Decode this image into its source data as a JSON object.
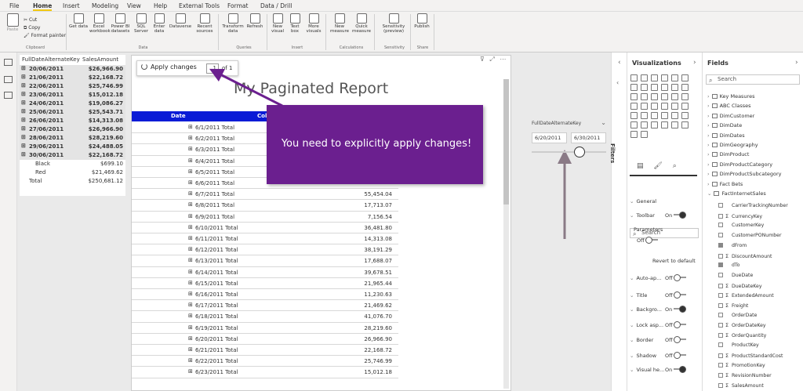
{
  "menu": {
    "tabs": [
      "File",
      "Home",
      "Insert",
      "Modeling",
      "View",
      "Help",
      "External Tools",
      "Format",
      "Data / Drill"
    ],
    "active": "Home"
  },
  "ribbon": {
    "clipboard": {
      "paste": "Paste",
      "cut": "Cut",
      "copy": "Copy",
      "format_painter": "Format painter",
      "group": "Clipboard"
    },
    "data_buttons": [
      "Get data",
      "Excel workbook",
      "Power BI datasets",
      "SQL Server",
      "Enter data",
      "Dataverse",
      "Recent sources"
    ],
    "data_group": "Data",
    "queries_buttons": [
      "Transform data",
      "Refresh"
    ],
    "queries_group": "Queries",
    "insert_buttons": [
      "New visual",
      "Text box",
      "More visuals"
    ],
    "insert_group": "Insert",
    "calc_buttons": [
      "New measure",
      "Quick measure"
    ],
    "calc_group": "Calculations",
    "sens_buttons": [
      "Sensitivity (preview)"
    ],
    "sens_group": "Sensitivity",
    "share_buttons": [
      "Publish"
    ],
    "share_group": "Share"
  },
  "matrix": {
    "headers": [
      "FullDateAlternateKey",
      "SalesAmount"
    ],
    "rows": [
      {
        "key": "20/06/2011",
        "value": "$26,966.90",
        "bold": true
      },
      {
        "key": "21/06/2011",
        "value": "$22,168.72",
        "bold": true
      },
      {
        "key": "22/06/2011",
        "value": "$25,746.99",
        "bold": true
      },
      {
        "key": "23/06/2011",
        "value": "$15,012.18",
        "bold": true
      },
      {
        "key": "24/06/2011",
        "value": "$19,086.27",
        "bold": true
      },
      {
        "key": "25/06/2011",
        "value": "$25,543.71",
        "bold": true
      },
      {
        "key": "26/06/2011",
        "value": "$14,313.08",
        "bold": true
      },
      {
        "key": "27/06/2011",
        "value": "$26,966.90",
        "bold": true
      },
      {
        "key": "28/06/2011",
        "value": "$28,219.60",
        "bold": true
      },
      {
        "key": "29/06/2011",
        "value": "$24,488.05",
        "bold": true
      },
      {
        "key": "30/06/2011",
        "value": "$22,168.72",
        "bold": true
      },
      {
        "key": "Black",
        "value": "$699.10",
        "bold": false
      },
      {
        "key": "Red",
        "value": "$21,469.62",
        "bold": false
      },
      {
        "key": "Total",
        "value": "$250,681.12",
        "bold": false
      }
    ]
  },
  "report": {
    "apply_label": "Apply changes",
    "page_value": "1",
    "page_of": "of 1",
    "title": "My Paginated Report",
    "col_date": "Date",
    "col_second": "Col",
    "rows": [
      {
        "date": "6/1/2011 Total",
        "amount": ""
      },
      {
        "date": "6/2/2011 Total",
        "amount": ""
      },
      {
        "date": "6/3/2011 Total",
        "amount": ""
      },
      {
        "date": "6/4/2011 Total",
        "amount": ""
      },
      {
        "date": "6/5/2011 Total",
        "amount": ""
      },
      {
        "date": "6/6/2011 Total",
        "amount": ""
      },
      {
        "date": "6/7/2011 Total",
        "amount": "55,454.04"
      },
      {
        "date": "6/8/2011 Total",
        "amount": "17,713.07"
      },
      {
        "date": "6/9/2011 Total",
        "amount": "7,156.54"
      },
      {
        "date": "6/10/2011 Total",
        "amount": "36,481.80"
      },
      {
        "date": "6/11/2011 Total",
        "amount": "14,313.08"
      },
      {
        "date": "6/12/2011 Total",
        "amount": "38,191.29"
      },
      {
        "date": "6/13/2011 Total",
        "amount": "17,688.07"
      },
      {
        "date": "6/14/2011 Total",
        "amount": "39,678.51"
      },
      {
        "date": "6/15/2011 Total",
        "amount": "21,965.44"
      },
      {
        "date": "6/16/2011 Total",
        "amount": "11,230.63"
      },
      {
        "date": "6/17/2011 Total",
        "amount": "21,469.62"
      },
      {
        "date": "6/18/2011 Total",
        "amount": "41,076.70"
      },
      {
        "date": "6/19/2011 Total",
        "amount": "28,219.60"
      },
      {
        "date": "6/20/2011 Total",
        "amount": "26,966.90"
      },
      {
        "date": "6/21/2011 Total",
        "amount": "22,168.72"
      },
      {
        "date": "6/22/2011 Total",
        "amount": "25,746.99"
      },
      {
        "date": "6/23/2011 Total",
        "amount": "15,012.18"
      }
    ]
  },
  "callout": "You need to explicitly apply changes!",
  "slicer": {
    "label": "FullDateAlternateKey",
    "from": "6/20/2011",
    "to": "6/30/2011"
  },
  "filters_label": "Filters",
  "viz": {
    "title": "Visualizations",
    "search": "Search",
    "sections": [
      {
        "label": "General"
      },
      {
        "label": "Toolbar",
        "state": "On"
      },
      {
        "label": "Parameters"
      },
      {
        "label": "Off",
        "state": "Off"
      },
      {
        "label": "Revert to default"
      },
      {
        "label": "Auto-ap...",
        "state": "Off"
      },
      {
        "label": "Title",
        "state": "Off"
      },
      {
        "label": "Backgro...",
        "state": "On"
      },
      {
        "label": "Lock asp...",
        "state": "Off"
      },
      {
        "label": "Border",
        "state": "Off"
      },
      {
        "label": "Shadow",
        "state": "Off"
      },
      {
        "label": "Visual he...",
        "state": "On"
      }
    ]
  },
  "fields": {
    "title": "Fields",
    "search": "Search",
    "tables": [
      "Key Measures",
      "ABC Classes",
      "DimCustomer",
      "DimDate",
      "DimDates",
      "DimGeography",
      "DimProduct",
      "DimProductCategory",
      "DimProductSubcategory",
      "Fact Bets",
      "FactInternetSales"
    ],
    "columns": [
      {
        "name": "CarrierTrackingNumber",
        "sigma": false,
        "checked": false
      },
      {
        "name": "CurrencyKey",
        "sigma": true,
        "checked": false
      },
      {
        "name": "CustomerKey",
        "sigma": false,
        "checked": false
      },
      {
        "name": "CustomerPONumber",
        "sigma": false,
        "checked": false
      },
      {
        "name": "dFrom",
        "sigma": false,
        "checked": true
      },
      {
        "name": "DiscountAmount",
        "sigma": true,
        "checked": false
      },
      {
        "name": "dTo",
        "sigma": false,
        "checked": true
      },
      {
        "name": "DueDate",
        "sigma": false,
        "checked": false
      },
      {
        "name": "DueDateKey",
        "sigma": true,
        "checked": false
      },
      {
        "name": "ExtendedAmount",
        "sigma": true,
        "checked": false
      },
      {
        "name": "Freight",
        "sigma": true,
        "checked": false
      },
      {
        "name": "OrderDate",
        "sigma": false,
        "checked": false
      },
      {
        "name": "OrderDateKey",
        "sigma": true,
        "checked": false
      },
      {
        "name": "OrderQuantity",
        "sigma": true,
        "checked": false
      },
      {
        "name": "ProductKey",
        "sigma": false,
        "checked": false
      },
      {
        "name": "ProductStandardCost",
        "sigma": true,
        "checked": false
      },
      {
        "name": "PromotionKey",
        "sigma": true,
        "checked": false
      },
      {
        "name": "RevisionNumber",
        "sigma": true,
        "checked": false
      },
      {
        "name": "SalesAmount",
        "sigma": true,
        "checked": false
      }
    ]
  },
  "colors": {
    "accent": "#f2c811",
    "report_header": "#0a1bd6",
    "callout": "#6b1f8f",
    "arrow": "#6b1f8f",
    "arrow2": "#8a7a86"
  }
}
